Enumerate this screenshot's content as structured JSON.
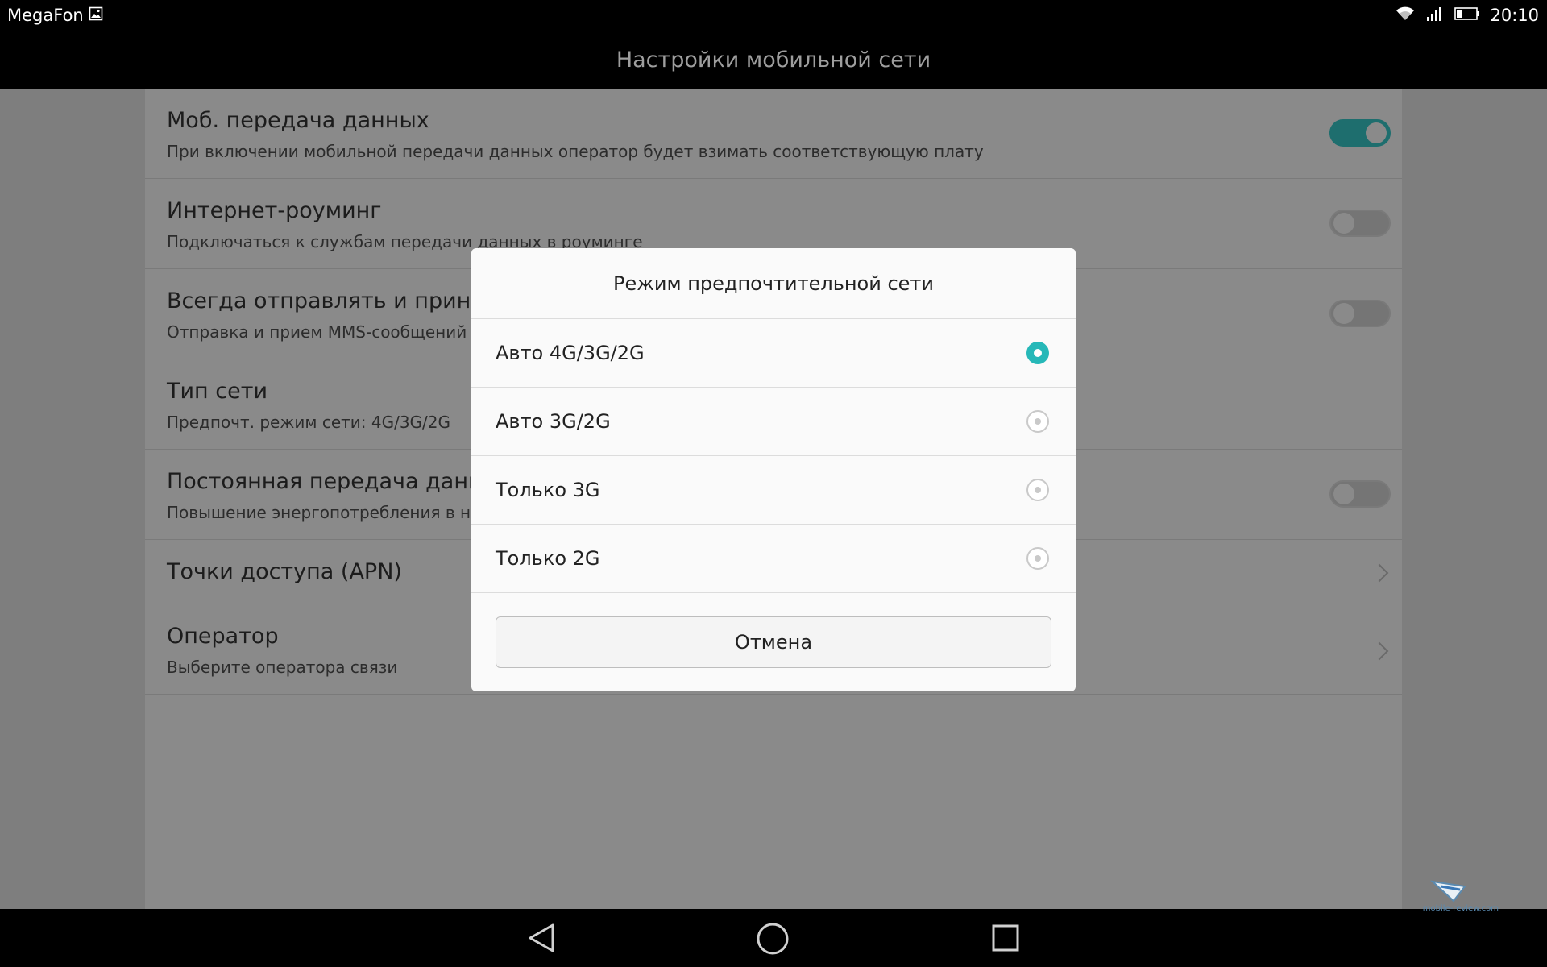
{
  "status_bar": {
    "carrier": "MegaFon",
    "time": "20:10",
    "icons": [
      "image-notification-icon",
      "wifi-icon",
      "signal-icon",
      "battery-icon"
    ]
  },
  "header": {
    "title": "Настройки мобильной сети"
  },
  "settings": {
    "items": [
      {
        "title": "Моб. передача данных",
        "subtitle": "При включении мобильной передачи данных оператор будет взимать соответствующую плату",
        "control": "toggle",
        "on": true
      },
      {
        "title": "Интернет-роуминг",
        "subtitle": "Подключаться к службам передачи данных в роуминге",
        "control": "toggle",
        "on": false
      },
      {
        "title": "Всегда отправлять и принима",
        "subtitle": "Отправка и прием MMS-сообщений бе",
        "control": "toggle",
        "on": false
      },
      {
        "title": "Тип сети",
        "subtitle": "Предпочт. режим сети: 4G/3G/2G",
        "control": "none"
      },
      {
        "title": "Постоянная передача данных",
        "subtitle": "Повышение энергопотребления в неко",
        "control": "toggle",
        "on": false
      },
      {
        "title": "Точки доступа (APN)",
        "subtitle": "",
        "control": "chevron"
      },
      {
        "title": "Оператор",
        "subtitle": "Выберите оператора связи",
        "control": "chevron"
      }
    ]
  },
  "dialog": {
    "title": "Режим предпочтительной сети",
    "options": [
      {
        "label": "Авто 4G/3G/2G",
        "selected": true
      },
      {
        "label": "Авто 3G/2G",
        "selected": false
      },
      {
        "label": "Только 3G",
        "selected": false
      },
      {
        "label": "Только 2G",
        "selected": false
      }
    ],
    "cancel_label": "Отмена"
  },
  "nav_bar": {
    "icons": [
      "back-icon",
      "home-icon",
      "recents-icon"
    ]
  },
  "colors": {
    "accent": "#26b8b8",
    "toggle_on": "#1e6e6e"
  },
  "watermark": "mobile-review.com"
}
